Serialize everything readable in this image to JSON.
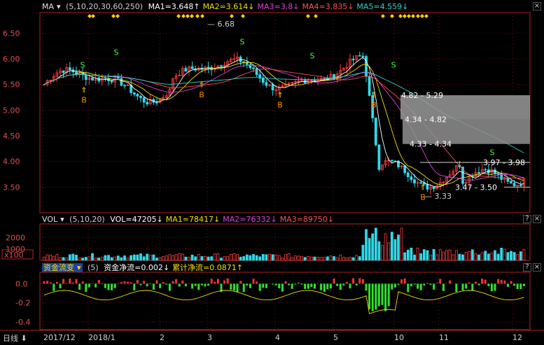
{
  "main_panel": {
    "indicator": "MA",
    "params": "(5,10,20,30,60,250)",
    "ma_values": [
      {
        "label": "MA1=3.648",
        "arrow": "↑",
        "color": "#ffffff"
      },
      {
        "label": "MA2=3.614",
        "arrow": "↓",
        "color": "#f0e000"
      },
      {
        "label": "MA3=3.8",
        "arrow": "↓",
        "color": "#e040e0"
      },
      {
        "label": "MA4=3.835",
        "arrow": "↓",
        "color": "#ff5050"
      },
      {
        "label": "MA5=4.559",
        "arrow": "↓",
        "color": "#30d0d0"
      }
    ],
    "y_ticks": [
      "6.50",
      "6.00",
      "5.50",
      "5.00",
      "4.50",
      "4.00",
      "3.50"
    ],
    "annotations": {
      "high": "6.68",
      "low": "3.33",
      "zone1": "4.82 - 5.29",
      "zone2": "4.34 - 4.82",
      "zone3": "4.33 - 4.34",
      "zone4": "3.97 - 3.98",
      "zone5": "3.47 - 3.50"
    },
    "buy_label": "B",
    "sell_label": "S"
  },
  "vol_panel": {
    "indicator": "VOL",
    "params": "(5,10,20)",
    "values": [
      {
        "label": "VOL=47205",
        "arrow": "↓",
        "color": "#ffffff"
      },
      {
        "label": "MA1=78417",
        "arrow": "↓",
        "color": "#f0e000"
      },
      {
        "label": "MA2=76332",
        "arrow": "↓",
        "color": "#e040e0"
      },
      {
        "label": "MA3=89750",
        "arrow": "↓",
        "color": "#ff5050"
      }
    ],
    "y_ticks": [
      "2000",
      "1000"
    ],
    "unit": "x100"
  },
  "flow_panel": {
    "indicator": "资金流变",
    "params": "(5)",
    "values": [
      {
        "label": "资金净流=0.002",
        "arrow": "↓",
        "color": "#ffffff"
      },
      {
        "label": "累计净流=0.0871",
        "arrow": "↑",
        "color": "#f0e000"
      }
    ],
    "y_ticks": [
      "0.0",
      "-0.2",
      "-0.4"
    ]
  },
  "x_axis": {
    "period": "日线",
    "labels": [
      "2017/12",
      "2018/1",
      "2",
      "3",
      "4",
      "5",
      "10",
      "11",
      "12"
    ]
  },
  "colors": {
    "up": "#ff3c3c",
    "down": "#30d8e8",
    "grid": "#7a1010",
    "axis": "#b02020"
  }
}
